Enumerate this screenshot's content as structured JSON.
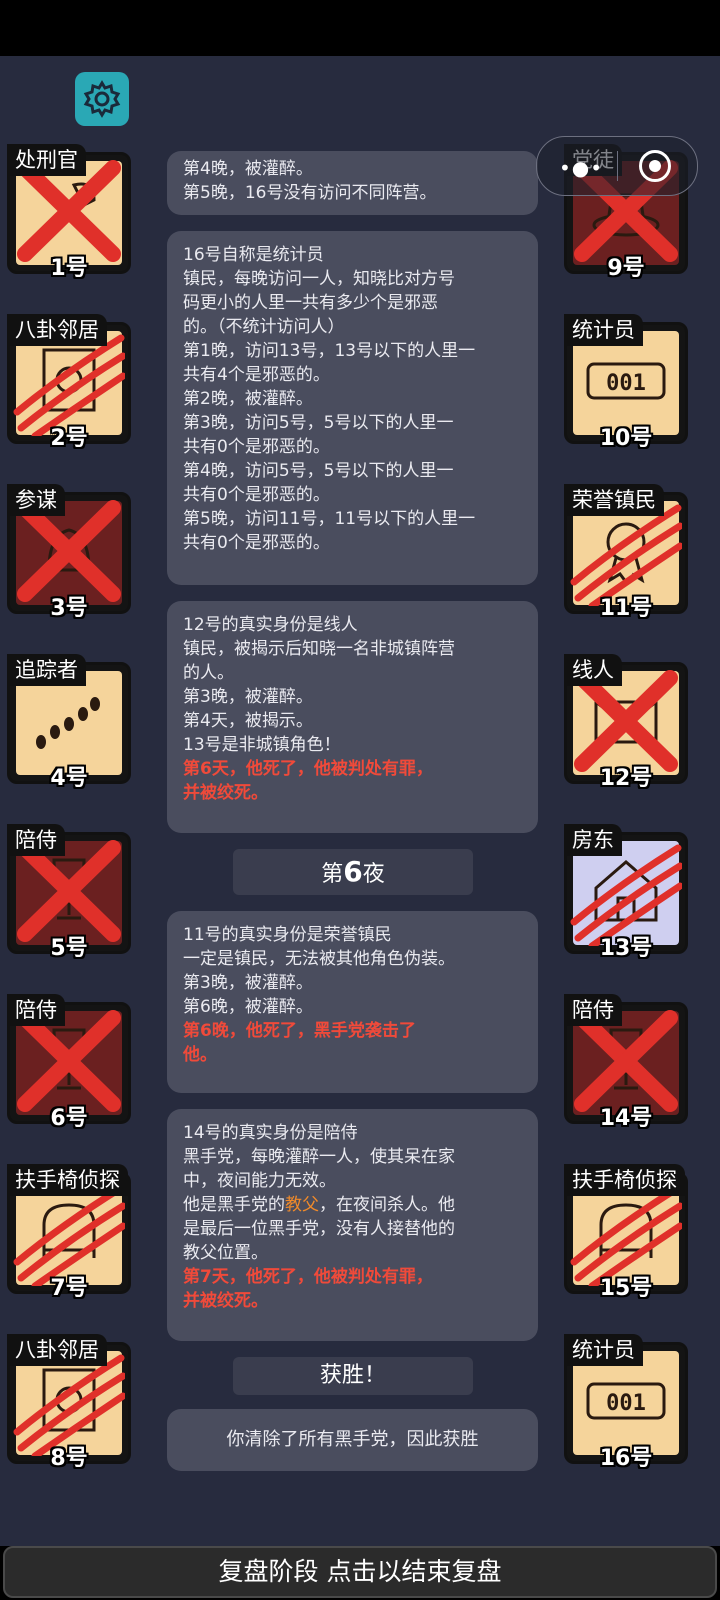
{
  "capsule": {
    "more_icon": "more-dots-icon",
    "close_icon": "record-icon"
  },
  "players_left": [
    {
      "role": "处刑官",
      "num": "1号",
      "bg": "town",
      "mark": "x",
      "icon": "axe-icon"
    },
    {
      "role": "八卦邻居",
      "num": "2号",
      "bg": "town",
      "mark": "claw",
      "icon": "neighbor-icon"
    },
    {
      "role": "参谋",
      "num": "3号",
      "bg": "evil",
      "mark": "x",
      "icon": "bell-icon"
    },
    {
      "role": "追踪者",
      "num": "4号",
      "bg": "town",
      "mark": "none",
      "icon": "footprints-icon"
    },
    {
      "role": "陪侍",
      "num": "5号",
      "bg": "evil",
      "mark": "x",
      "icon": "glass-icon"
    },
    {
      "role": "陪侍",
      "num": "6号",
      "bg": "evil",
      "mark": "x",
      "icon": "glass-icon"
    },
    {
      "role": "扶手椅侦探",
      "num": "7号",
      "bg": "town",
      "mark": "claw",
      "icon": "armchair-icon"
    },
    {
      "role": "八卦邻居",
      "num": "8号",
      "bg": "town",
      "mark": "claw",
      "icon": "neighbor-icon"
    }
  ],
  "players_right": [
    {
      "role": "党徒",
      "num": "9号",
      "bg": "evil",
      "mark": "x",
      "icon": "hat-icon"
    },
    {
      "role": "统计员",
      "num": "10号",
      "bg": "town",
      "mark": "none",
      "icon": "counter-icon",
      "counter": "001"
    },
    {
      "role": "荣誉镇民",
      "num": "11号",
      "bg": "town",
      "mark": "claw",
      "icon": "medal-icon"
    },
    {
      "role": "线人",
      "num": "12号",
      "bg": "town",
      "mark": "x",
      "icon": "envelope-icon"
    },
    {
      "role": "房东",
      "num": "13号",
      "bg": "purple",
      "mark": "claw",
      "icon": "house-icon"
    },
    {
      "role": "陪侍",
      "num": "14号",
      "bg": "evil",
      "mark": "x",
      "icon": "glass-icon"
    },
    {
      "role": "扶手椅侦探",
      "num": "15号",
      "bg": "town",
      "mark": "claw",
      "icon": "armchair-icon"
    },
    {
      "role": "统计员",
      "num": "16号",
      "bg": "town",
      "mark": "none",
      "icon": "counter-icon",
      "counter": "001"
    }
  ],
  "log": {
    "b1": [
      "第4晚，被灌醉。",
      "第5晚，16号没有访问不同阵营。"
    ],
    "b2": [
      "16号自称是统计员",
      "镇民，每晚访问一人，知晓比对方号",
      "码更小的人里一共有多少个是邪恶",
      "的。（不统计访问人）",
      "第1晚，访问13号，13号以下的人里一",
      "共有4个是邪恶的。",
      "第2晚，被灌醉。",
      "第3晚，访问5号，5号以下的人里一",
      "共有0个是邪恶的。",
      "第4晚，访问5号，5号以下的人里一",
      "共有0个是邪恶的。",
      "第5晚，访问11号，11号以下的人里一",
      "共有0个是邪恶的。"
    ],
    "b3": [
      "12号的真实身份是线人",
      "镇民，被揭示后知晓一名非城镇阵营",
      "的人。",
      "第3晚，被灌醉。",
      "第4天，被揭示。",
      "13号是非城镇角色！"
    ],
    "b3_red": [
      "第6天，他死了，他被判处有罪，",
      "并被绞死。"
    ],
    "night_prefix": "第",
    "night_num": "6",
    "night_suffix": "夜",
    "b4": [
      "11号的真实身份是荣誉镇民",
      "一定是镇民，无法被其他角色伪装。",
      "第3晚，被灌醉。",
      "第6晚，被灌醉。"
    ],
    "b4_red": [
      "第6晚，他死了，黑手党袭击了",
      "他。"
    ],
    "b5": [
      "14号的真实身份是陪侍",
      "黑手党，每晚灌醉一人，使其呆在家",
      "中，夜间能力无效。"
    ],
    "b5_mid_a": "他是黑手党的",
    "b5_mid_orange": "教父",
    "b5_mid_b": "，在夜间杀人。他",
    "b5_tail": [
      "是最后一位黑手党，没有人接替他的",
      "教父位置。"
    ],
    "b5_red": [
      "第7天，他死了，他被判处有罪，",
      "并被绞死。"
    ],
    "victory": "获胜！",
    "b6": "你清除了所有黑手党，因此获胜"
  },
  "bottom_button": "复盘阶段 点击以结束复盘",
  "colors": {
    "town": "#f5d49b",
    "evil": "#6b2020",
    "purple": "#cfcff0",
    "mark": "#e0302a",
    "panel": "#272b3e",
    "bubble": "#4a4d5e"
  }
}
